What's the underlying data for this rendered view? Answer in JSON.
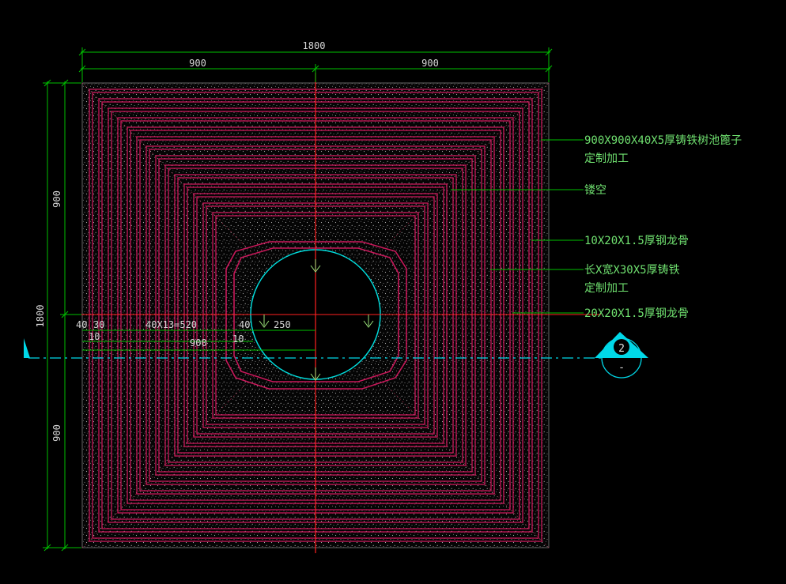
{
  "drawing": {
    "overall_width": "1800",
    "left_half": "900",
    "right_half": "900",
    "overall_height": "1800",
    "upper_half": "900",
    "lower_half": "900"
  },
  "annotations": {
    "grate_line1": "900X900X40X5厚铸铁树池篦子",
    "grate_line2": "定制加工",
    "hollow": "镂空",
    "keel_small": "10X20X1.5厚钢龙骨",
    "iron_strip_line1": "长X宽X30X5厚铸铁",
    "iron_strip_line2": "定制加工",
    "keel_large": "20X20X1.5厚钢龙骨"
  },
  "inner_dims": {
    "d40a": "40",
    "d30": "30",
    "d10a": "10",
    "spacing": "40X13=520",
    "d900": "900",
    "d40b": "40",
    "d10b": "10",
    "d250": "250"
  },
  "section_mark": {
    "number": "2",
    "sheet": "-"
  },
  "colors": {
    "background": "#000000",
    "dimension": "#00c000",
    "strip": "#c8185a",
    "axis": "#ff2020",
    "circle": "#00e0e0",
    "text": "#e0e0e0",
    "leader_text": "#6fe06f"
  }
}
